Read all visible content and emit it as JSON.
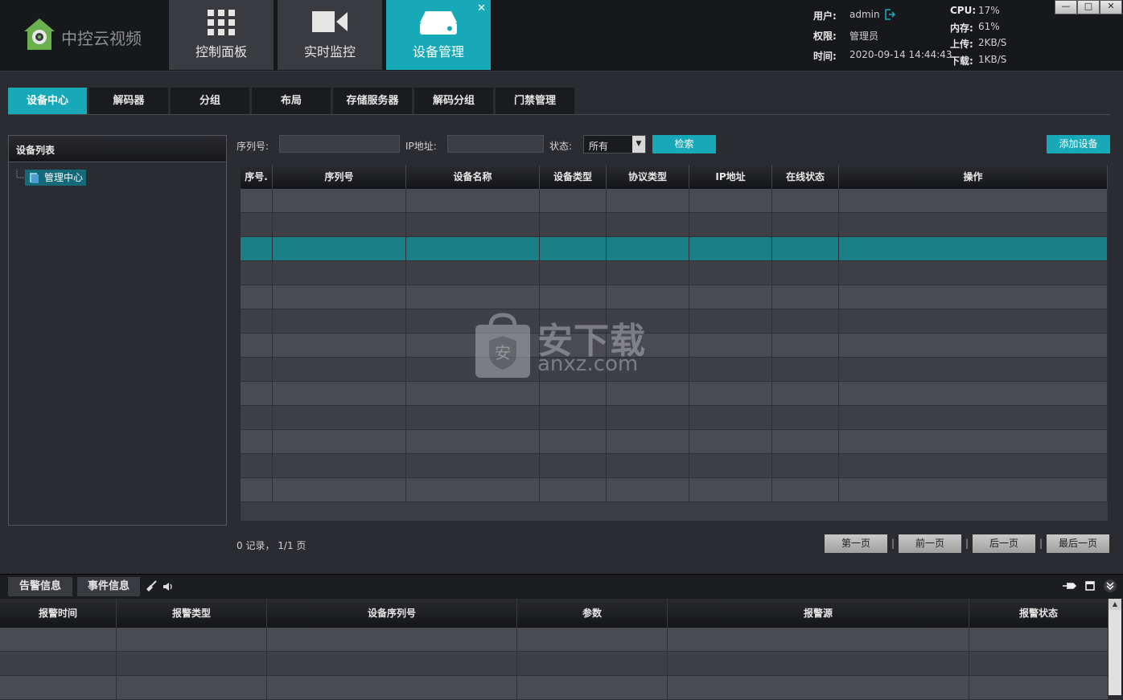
{
  "app": {
    "title": "中控云视频"
  },
  "main_tabs": [
    {
      "label": "控制面板",
      "icon": "grid-icon"
    },
    {
      "label": "实时监控",
      "icon": "camera-icon"
    },
    {
      "label": "设备管理",
      "icon": "device-icon",
      "active": true
    }
  ],
  "main_tab_close": "✕",
  "session": {
    "user_label": "用户:",
    "user_value": "admin",
    "role_label": "权限:",
    "role_value": "管理员",
    "time_label": "时间:",
    "time_value": "2020-09-14 14:44:43"
  },
  "stats": {
    "cpu_label": "CPU:",
    "cpu_value": "17%",
    "mem_label": "内存:",
    "mem_value": "61%",
    "up_label": "上传:",
    "up_value": "2KB/S",
    "down_label": "下载:",
    "down_value": "1KB/S"
  },
  "window_controls": {
    "minimize": "—",
    "maximize": "□",
    "close": "✕"
  },
  "sub_tabs": [
    "设备中心",
    "解码器",
    "分组",
    "布局",
    "存储服务器",
    "解码分组",
    "门禁管理"
  ],
  "device_panel": {
    "title": "设备列表",
    "root_node": "管理中心"
  },
  "search": {
    "serial_label": "序列号:",
    "serial_value": "",
    "ip_label": "IP地址:",
    "ip_value": "",
    "status_label": "状态:",
    "status_value": "所有",
    "search_button": "检索",
    "add_button": "添加设备"
  },
  "device_table": {
    "columns": [
      "序号.",
      "序列号",
      "设备名称",
      "设备类型",
      "协议类型",
      "IP地址",
      "在线状态",
      "操作"
    ],
    "empty_rows": 13,
    "selected_row": 3
  },
  "watermark": {
    "line1": "安下载",
    "line2": "anxz.com",
    "badge": "安"
  },
  "pagination": {
    "records": "0  记录，  1/1 页",
    "first": "第一页",
    "prev": "前一页",
    "next": "后一页",
    "last": "最后一页"
  },
  "bottom_tabs": {
    "alarm": "告警信息",
    "event": "事件信息"
  },
  "alarm_table": {
    "columns": [
      "报警时间",
      "报警类型",
      "设备序列号",
      "参数",
      "报警源",
      "报警状态"
    ],
    "empty_rows": 3
  },
  "colors": {
    "accent": "#18a9b8",
    "selected_row": "#1b7f86"
  }
}
